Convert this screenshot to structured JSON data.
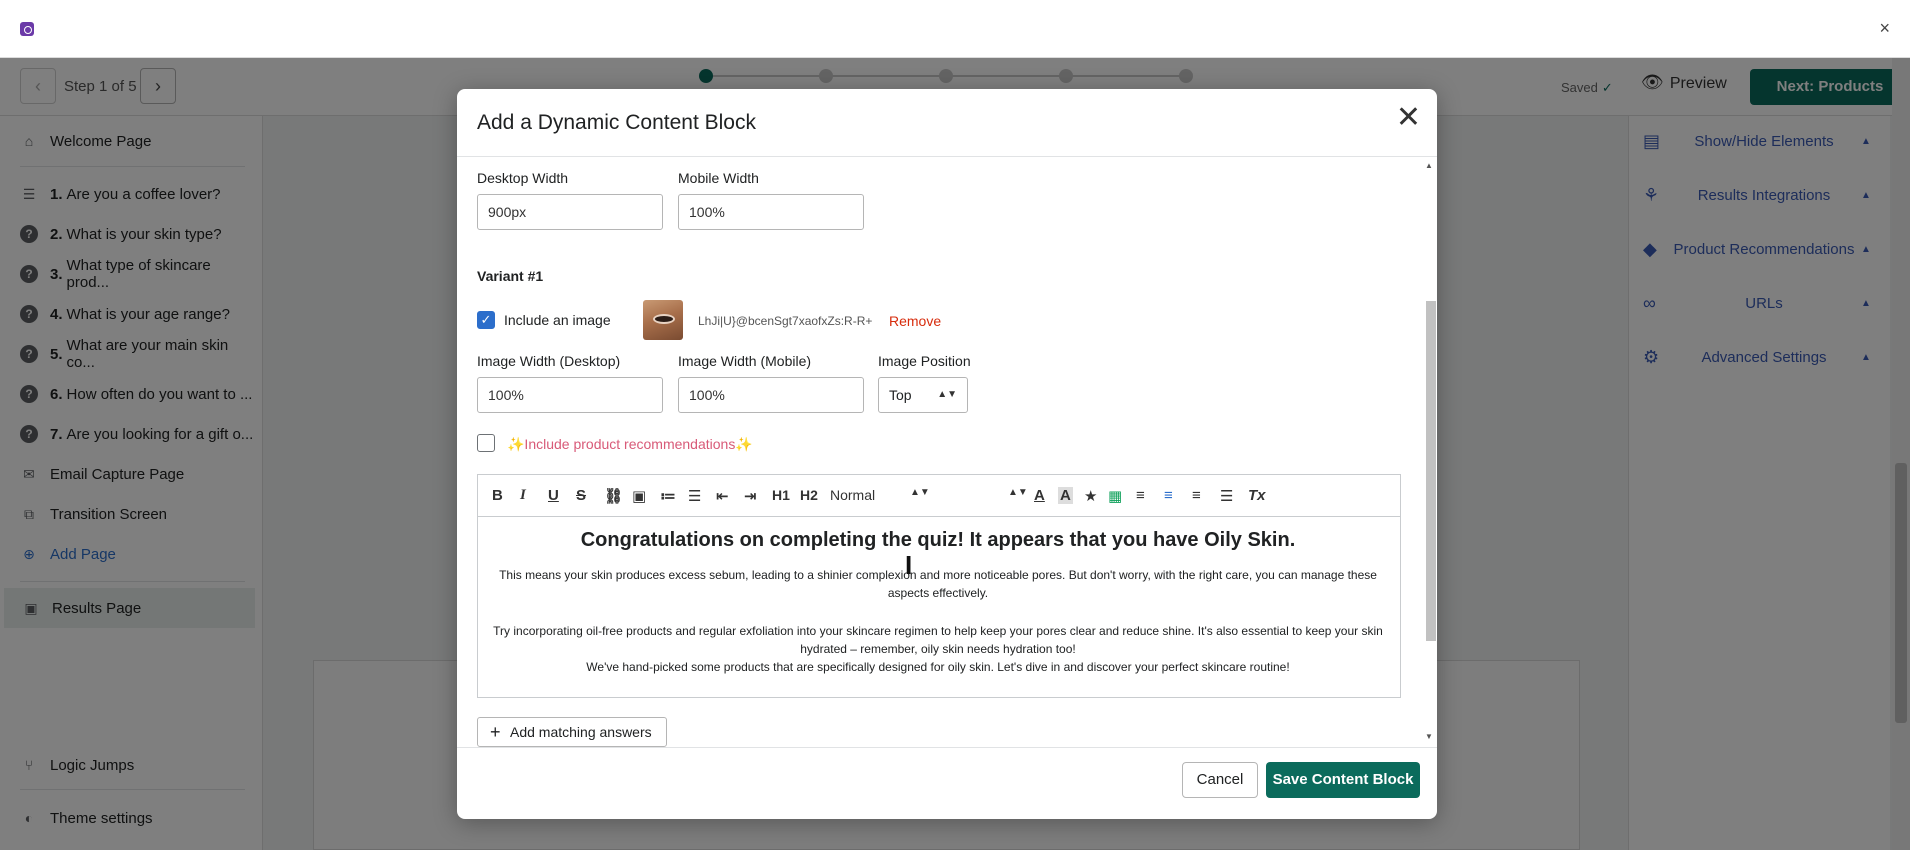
{
  "window": {
    "close_glyph": "×"
  },
  "stepbar": {
    "step_label": "Step 1 of 5",
    "saved_label": "Saved",
    "preview_label": "Preview",
    "next_label": "Next: Products"
  },
  "sidebar": {
    "welcome": "Welcome Page",
    "questions": [
      {
        "num": "1.",
        "label": "Are you a coffee lover?"
      },
      {
        "num": "2.",
        "label": "What is your skin type?"
      },
      {
        "num": "3.",
        "label": "What type of skincare prod..."
      },
      {
        "num": "4.",
        "label": "What is your age range?"
      },
      {
        "num": "5.",
        "label": "What are your main skin co..."
      },
      {
        "num": "6.",
        "label": "How often do you want to ..."
      },
      {
        "num": "7.",
        "label": "Are you looking for a gift o..."
      }
    ],
    "email_capture": "Email Capture Page",
    "transition": "Transition Screen",
    "add_page": "Add Page",
    "results": "Results Page",
    "logic_jumps": "Logic Jumps",
    "theme_settings": "Theme settings"
  },
  "right_sidebar": {
    "items": [
      {
        "label": "Show/Hide Elements",
        "icon": "layout-icon"
      },
      {
        "label": "Results Integrations",
        "icon": "integrations-icon"
      },
      {
        "label": "Product Recommendations",
        "icon": "tag-icon"
      },
      {
        "label": "URLs",
        "icon": "link-icon"
      },
      {
        "label": "Advanced Settings",
        "icon": "gear-icon"
      }
    ]
  },
  "modal": {
    "title": "Add a Dynamic Content Block",
    "desktop_width_label": "Desktop Width",
    "desktop_width_value": "900px",
    "mobile_width_label": "Mobile Width",
    "mobile_width_value": "100%",
    "variant_label": "Variant #1",
    "include_image_label": "Include an image",
    "include_image_checked": true,
    "image_filename": "LhJi|U}@bcenSgt7xaofxZs:R-R+",
    "remove_label": "Remove",
    "image_width_desktop_label": "Image Width (Desktop)",
    "image_width_desktop_value": "100%",
    "image_width_mobile_label": "Image Width (Mobile)",
    "image_width_mobile_value": "100%",
    "image_position_label": "Image Position",
    "image_position_value": "Top",
    "include_recs_label": "✨Include product recommendations✨",
    "include_recs_checked": false,
    "editor": {
      "format_select": "Normal",
      "heading": "Congratulations on completing the quiz! It appears that you have Oily Skin.",
      "para1": "This means your skin produces excess sebum, leading to a shinier complexion and more noticeable pores. But don't worry, with the right care, you can manage these aspects effectively.",
      "para2": "Try incorporating oil-free products and regular exfoliation into your skincare regimen to help keep your pores clear and reduce shine. It's also essential to keep your skin hydrated – remember, oily skin needs hydration too!",
      "para3": "We've hand-picked some products that are specifically designed for oily skin. Let's dive in and discover your perfect skincare routine!"
    },
    "add_matching_label": "Add matching answers",
    "cancel_label": "Cancel",
    "save_label": "Save Content Block"
  },
  "colors": {
    "primary": "#0b6b5c",
    "link": "#2c6ecb",
    "danger": "#d72c0d",
    "accent_pink": "#d85a78"
  }
}
